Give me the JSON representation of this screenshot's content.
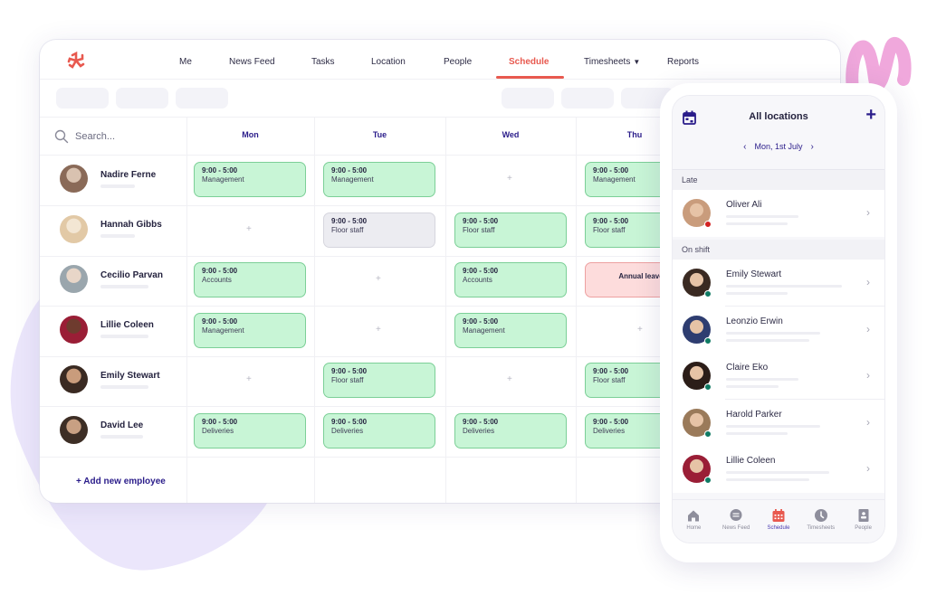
{
  "nav": {
    "items": [
      {
        "label": "Me",
        "active": false
      },
      {
        "label": "News Feed",
        "active": false
      },
      {
        "label": "Tasks",
        "active": false
      },
      {
        "label": "Location",
        "active": false
      },
      {
        "label": "People",
        "active": false
      },
      {
        "label": "Schedule",
        "active": true
      },
      {
        "label": "Timesheets",
        "active": false,
        "dropdown": true
      },
      {
        "label": "Reports",
        "active": false
      }
    ],
    "timesheets_caret": "▼"
  },
  "colors": {
    "brand": "#e8594f",
    "accent": "#2a1c8a",
    "shift_green": "#c8f5d6",
    "shift_grey": "#ececf1",
    "leave_red": "#fddcdc",
    "status_late": "#d32222",
    "status_on_shift": "#0f7a63"
  },
  "schedule": {
    "search_placeholder": "Search...",
    "days": [
      "Mon",
      "Tue",
      "Wed",
      "Thu"
    ],
    "add_cell_symbol": "+",
    "add_employee_label": "+ Add new employee",
    "employees": [
      {
        "name": "Nadire Ferne",
        "shifts": [
          {
            "type": "shift",
            "time": "9:00 - 5:00",
            "role": "Management"
          },
          {
            "type": "shift",
            "time": "9:00 - 5:00",
            "role": "Management"
          },
          {
            "type": "empty"
          },
          {
            "type": "shift",
            "time": "9:00 - 5:00",
            "role": "Management"
          }
        ]
      },
      {
        "name": "Hannah Gibbs",
        "shifts": [
          {
            "type": "empty"
          },
          {
            "type": "shift-grey",
            "time": "9:00 - 5:00",
            "role": "Floor staff"
          },
          {
            "type": "shift",
            "time": "9:00 - 5:00",
            "role": "Floor staff"
          },
          {
            "type": "shift",
            "time": "9:00 - 5:00",
            "role": "Floor staff"
          }
        ]
      },
      {
        "name": "Cecilio Parvan",
        "shifts": [
          {
            "type": "shift",
            "time": "9:00 - 5:00",
            "role": "Accounts"
          },
          {
            "type": "empty"
          },
          {
            "type": "shift",
            "time": "9:00 - 5:00",
            "role": "Accounts"
          },
          {
            "type": "leave",
            "label": "Annual leave"
          }
        ]
      },
      {
        "name": "Lillie Coleen",
        "shifts": [
          {
            "type": "shift",
            "time": "9:00 - 5:00",
            "role": "Management"
          },
          {
            "type": "empty"
          },
          {
            "type": "shift",
            "time": "9:00 - 5:00",
            "role": "Management"
          },
          {
            "type": "empty"
          }
        ]
      },
      {
        "name": "Emily Stewart",
        "shifts": [
          {
            "type": "empty"
          },
          {
            "type": "shift",
            "time": "9:00 - 5:00",
            "role": "Floor staff"
          },
          {
            "type": "empty"
          },
          {
            "type": "shift",
            "time": "9:00 - 5:00",
            "role": "Floor staff"
          }
        ]
      },
      {
        "name": "David Lee",
        "shifts": [
          {
            "type": "shift",
            "time": "9:00 - 5:00",
            "role": "Deliveries"
          },
          {
            "type": "shift",
            "time": "9:00 - 5:00",
            "role": "Deliveries"
          },
          {
            "type": "shift",
            "time": "9:00 - 5:00",
            "role": "Deliveries"
          },
          {
            "type": "shift",
            "time": "9:00 - 5:00",
            "role": "Deliveries"
          }
        ]
      }
    ]
  },
  "phone": {
    "title": "All locations",
    "date": "Mon, 1st July",
    "prev_arrow": "‹",
    "next_arrow": "›",
    "add_symbol": "+",
    "chevron": "›",
    "sections": [
      {
        "label": "Late",
        "status": "late",
        "people": [
          "Oliver Ali"
        ]
      },
      {
        "label": "On shift",
        "status": "on_shift",
        "people": [
          "Emily Stewart",
          "Leonzio Erwin",
          "Claire Eko",
          "Harold Parker",
          "Lillie Coleen"
        ]
      }
    ],
    "tabs": [
      {
        "label": "Home",
        "icon": "home-icon",
        "active": false
      },
      {
        "label": "News Feed",
        "icon": "chat-bubble-icon",
        "active": false
      },
      {
        "label": "Schedule",
        "icon": "calendar-icon",
        "active": true
      },
      {
        "label": "Timesheets",
        "icon": "clock-icon",
        "active": false
      },
      {
        "label": "People",
        "icon": "contact-book-icon",
        "active": false
      }
    ]
  }
}
